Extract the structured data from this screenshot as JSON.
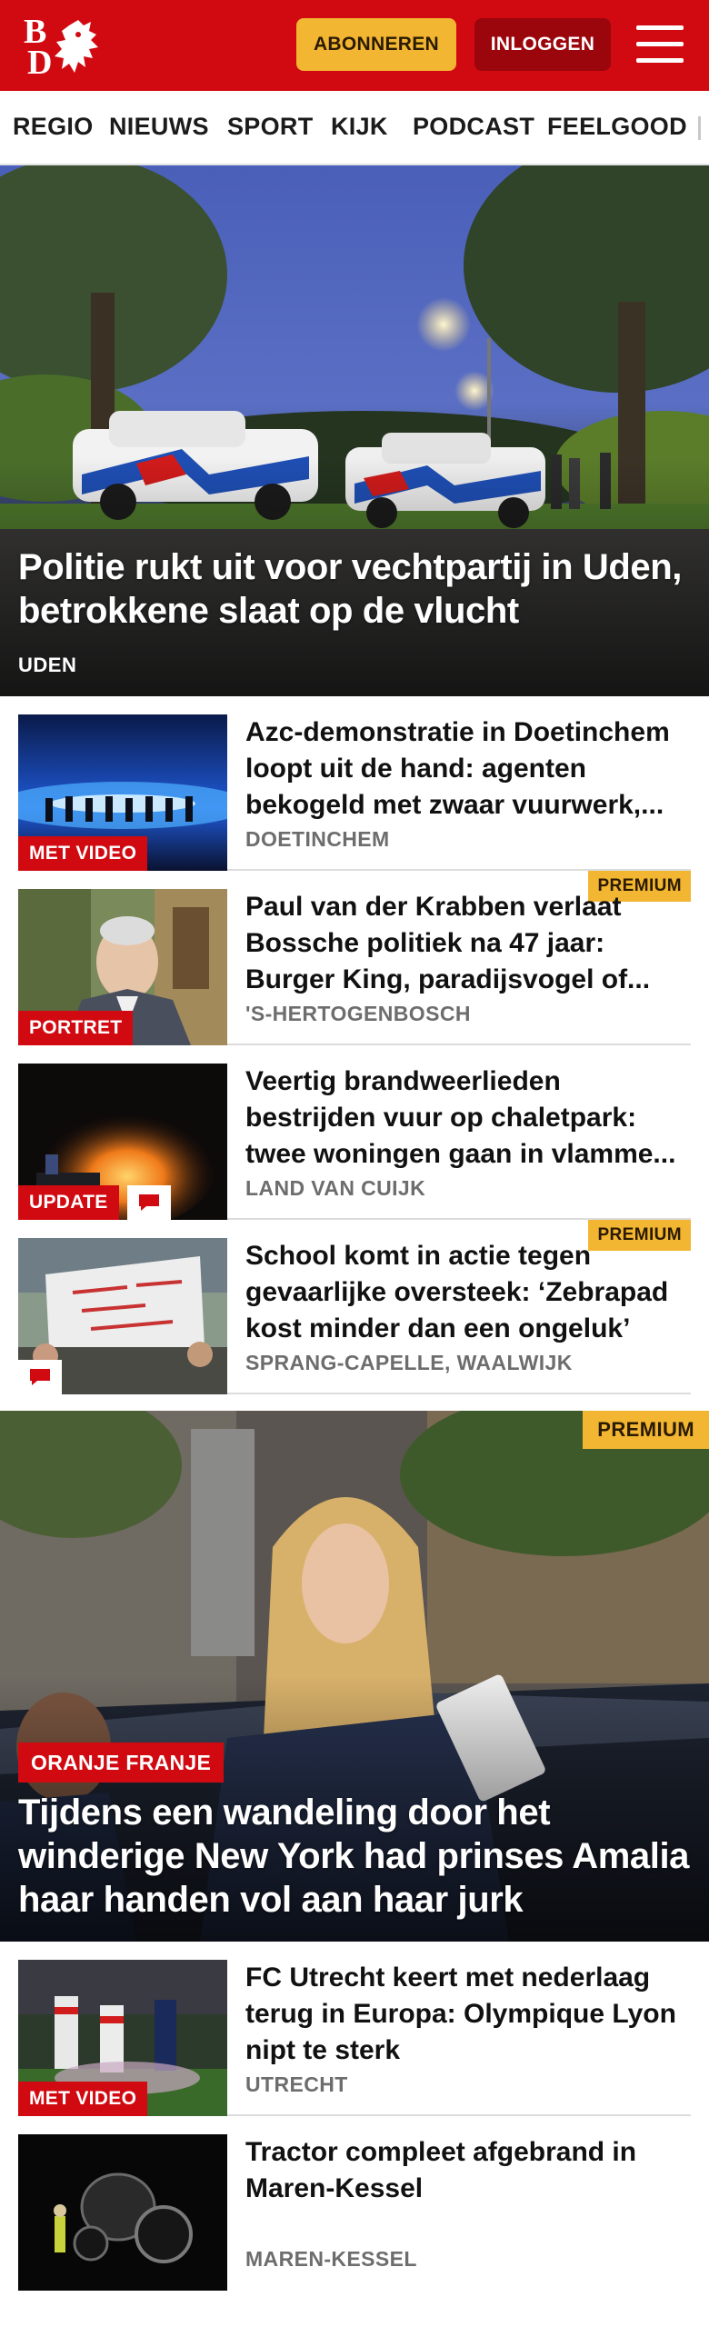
{
  "header": {
    "logo_letters": [
      "B",
      "D"
    ],
    "subscribe_label": "ABONNEREN",
    "login_label": "INLOGGEN",
    "brand_color": "#d10a11",
    "subscribe_color": "#f2b632"
  },
  "nav": {
    "items": [
      "REGIO",
      "NIEUWS",
      "SPORT",
      "KIJK",
      "PODCAST",
      "FEELGOOD"
    ]
  },
  "hero": {
    "title": "Politie rukt uit voor vechtpartij in Uden, betrokkene slaat op de vlucht",
    "location": "UDEN"
  },
  "articles": [
    {
      "title": "Azc-demonstratie in Doetinchem loopt uit de hand: agenten bekogeld met zwaar vuurwerk,...",
      "location": "DOETINCHEM",
      "label": "MET VIDEO"
    },
    {
      "title": "Paul van der Krabben verlaat Bossche politiek na 47 jaar: Burger King, paradijsvogel of...",
      "location": "'S-HERTOGENBOSCH",
      "label": "PORTRET",
      "premium": "PREMIUM"
    },
    {
      "title": "Veertig brandweerlieden bestrijden vuur op chaletpark: twee woningen gaan in vlamme...",
      "location": "LAND VAN CUIJK",
      "label": "UPDATE"
    },
    {
      "title": "School komt in actie tegen gevaarlijke oversteek: ‘Zebrapad kost minder dan een ongeluk’",
      "location": "SPRANG-CAPELLE, WAALWIJK",
      "premium": "PREMIUM"
    }
  ],
  "feature": {
    "premium": "PREMIUM",
    "label": "ORANJE FRANJE",
    "title": "Tijdens een wandeling door het winderige New York had prinses Amalia haar handen vol aan haar jurk"
  },
  "articles2": [
    {
      "title": "FC Utrecht keert met nederlaag terug in Europa: Olympique Lyon nipt te sterk",
      "location": "UTRECHT",
      "label": "MET VIDEO"
    },
    {
      "title": "Tractor compleet afgebrand in Maren-Kessel",
      "location": "MAREN-KESSEL"
    }
  ]
}
